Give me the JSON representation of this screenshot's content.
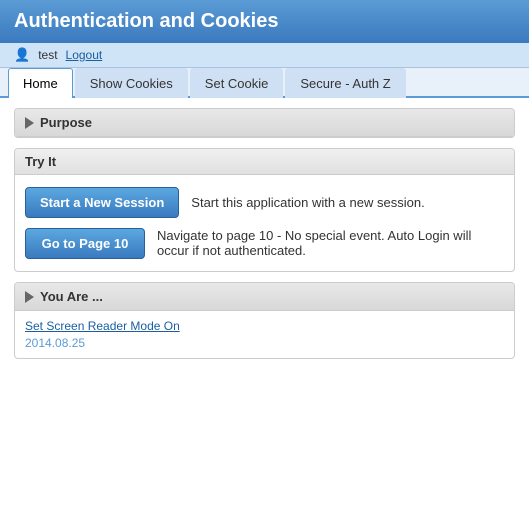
{
  "header": {
    "title": "Authentication and Cookies"
  },
  "userbar": {
    "user_label": "test",
    "logout_label": "Logout",
    "user_icon": "👤"
  },
  "tabs": [
    {
      "id": "home",
      "label": "Home",
      "active": true
    },
    {
      "id": "show-cookies",
      "label": "Show Cookies",
      "active": false
    },
    {
      "id": "set-cookie",
      "label": "Set Cookie",
      "active": false
    },
    {
      "id": "secure-authz",
      "label": "Secure - Auth Z",
      "active": false
    }
  ],
  "purpose_section": {
    "title": "Purpose"
  },
  "try_it_section": {
    "header": "Try It",
    "button1_label": "Start a New Session",
    "button1_desc": "Start this application with a new session.",
    "button2_label": "Go to Page 10",
    "button2_desc": "Navigate to page 10 - No special event. Auto Login will occur if not authenticated."
  },
  "you_are_section": {
    "title": "You Are ...",
    "link_label": "Set Screen Reader Mode On",
    "version": "2014.08.25"
  }
}
